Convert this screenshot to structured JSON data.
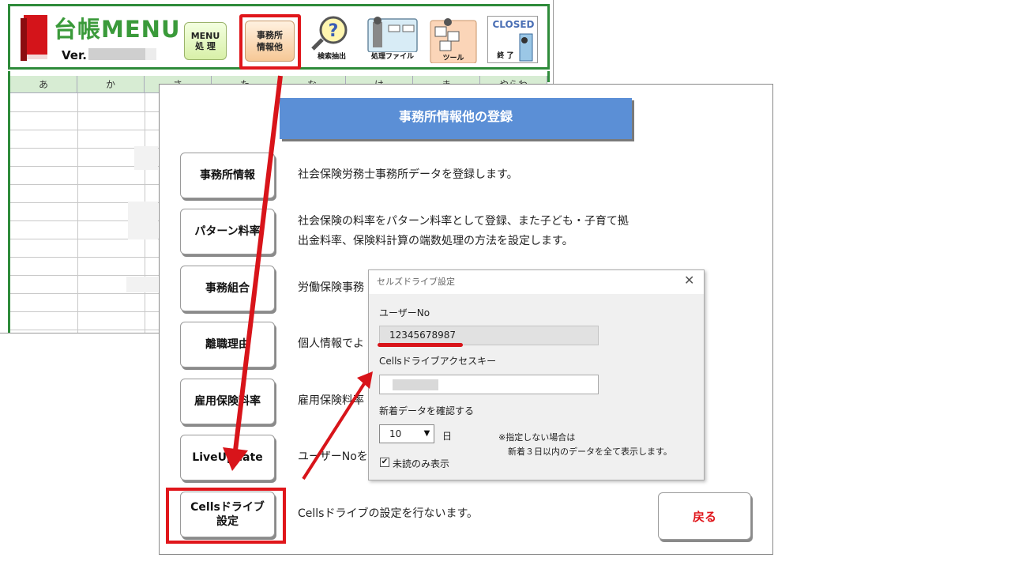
{
  "menu": {
    "title": "台帳MENU",
    "version_label": "Ver.",
    "toolbar": {
      "menu_btn": "MENU\n処 理",
      "office_btn": "事務所\n情報他",
      "search_caption": "検索抽出",
      "process_caption": "処理ファイル",
      "tools_caption": "ツール",
      "closed_top": "CLOSED",
      "closed_caption": "終 了"
    },
    "columns": [
      "あ",
      "か",
      "さ",
      "た",
      "な",
      "は",
      "ま",
      "やらわ"
    ]
  },
  "panel": {
    "title": "事務所情報他の登録",
    "items": [
      {
        "label": "事務所情報",
        "desc": "社会保険労務士事務所データを登録します。"
      },
      {
        "label": "パターン料率",
        "desc": "社会保険の料率をパターン料率として登録、また子ども・子育て拠\n出金料率、保険料計算の端数処理の方法を設定します。"
      },
      {
        "label": "事務組合",
        "desc": "労働保険事務"
      },
      {
        "label": "離職理由",
        "desc": "個人情報でよ"
      },
      {
        "label": "雇用保険料率",
        "desc": "雇用保険料率"
      },
      {
        "label": "LiveUpdate",
        "desc": "ユーザーNoを"
      },
      {
        "label": "Cellsドライブ\n設定",
        "desc": "Cellsドライブの設定を行ないます。"
      }
    ],
    "back_label": "戻る"
  },
  "dialog": {
    "title": "セルズドライブ設定",
    "close_glyph": "✕",
    "user_no_label": "ユーザーNo",
    "user_no_value": "12345678987",
    "access_key_label": "Cellsドライブアクセスキー",
    "new_data_label": "新着データを確認する",
    "days_value": "10",
    "days_unit": "日",
    "note_line1": "※指定しない場合は",
    "note_line2": "新着３日以内のデータを全て表示します。",
    "unread_only_label": "未読のみ表示",
    "unread_only_checked": true
  },
  "colors": {
    "accent_red": "#e0161b",
    "header_green": "#2e8b3a",
    "panel_title_blue": "#5b8fd6"
  }
}
